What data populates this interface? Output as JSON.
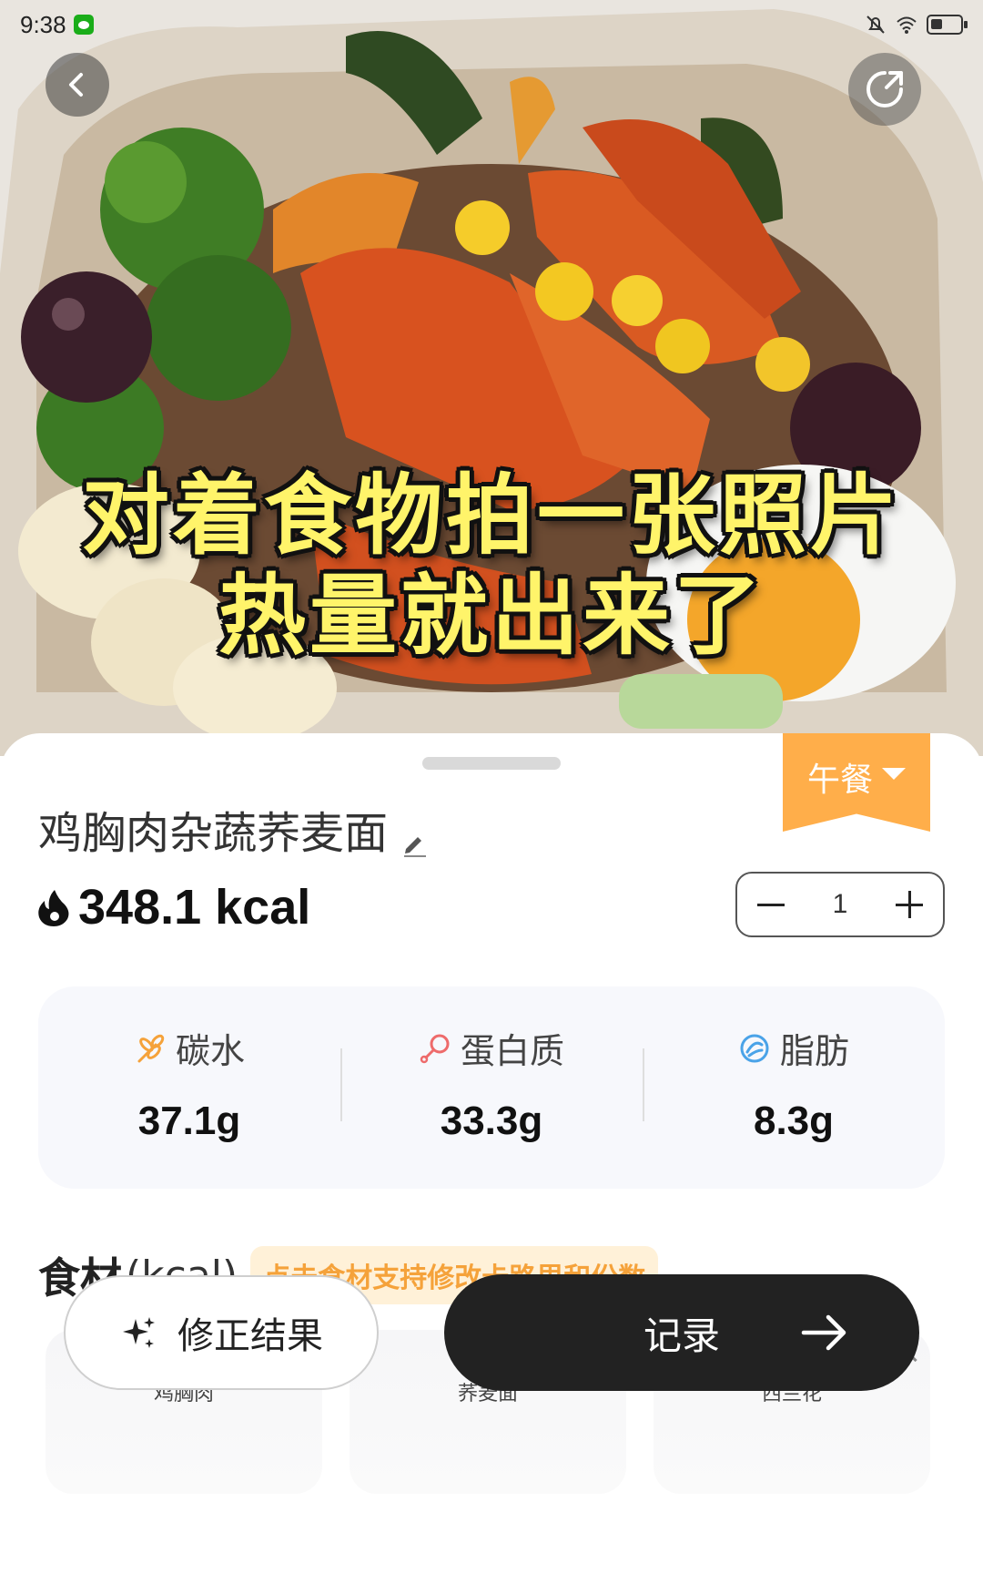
{
  "status_bar": {
    "time": "9:38"
  },
  "overlay_caption": {
    "line1": "对着食物拍一张照片",
    "line2": "热量就出来了"
  },
  "meal": {
    "type": "午餐"
  },
  "food": {
    "name": "鸡胸肉杂蔬荞麦面",
    "calories": "348.1 kcal",
    "quantity": "1"
  },
  "nutrition": [
    {
      "label": "碳水",
      "value": "37.1g",
      "icon": "wheat-icon"
    },
    {
      "label": "蛋白质",
      "value": "33.3g",
      "icon": "drumstick-icon"
    },
    {
      "label": "脂肪",
      "value": "8.3g",
      "icon": "oil-drop-icon"
    }
  ],
  "ingredients_section": {
    "title": "食材",
    "unit": "(kcal)",
    "hint": "点击食材支持修改卡路里和份数",
    "items": [
      {
        "name": "鸡胸肉"
      },
      {
        "name": "荞麦面"
      },
      {
        "name": "西兰花"
      }
    ]
  },
  "actions": {
    "correct_label": "修正结果",
    "record_label": "记录"
  },
  "colors": {
    "accent_orange": "#ffae4a",
    "hint_bg": "#fff1d8",
    "hint_text": "#f5a23a",
    "primary_button": "#222222",
    "overlay_text": "#fff46a"
  }
}
